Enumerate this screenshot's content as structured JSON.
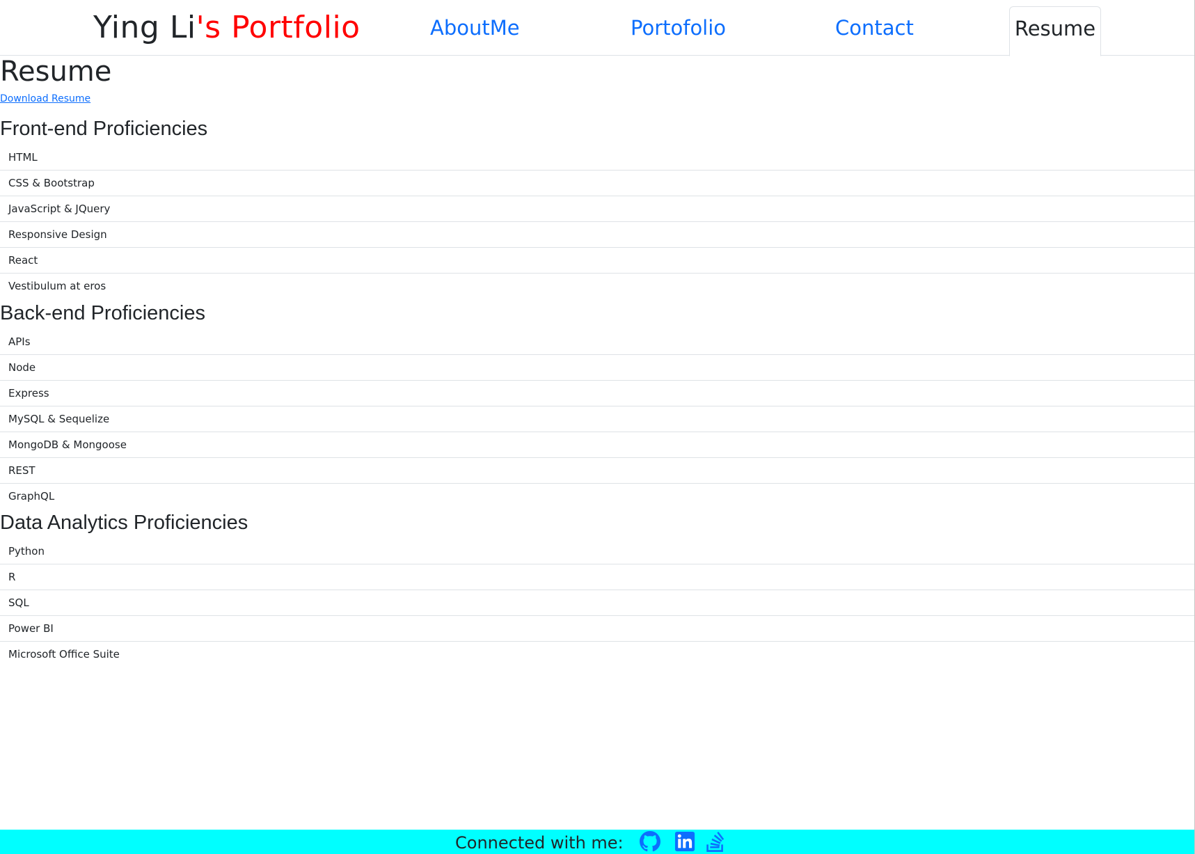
{
  "header": {
    "brand_part1": "Ying Li",
    "brand_part2": "'s Portfolio",
    "nav": {
      "about": "AboutMe",
      "portfolio": "Portofolio",
      "contact": "Contact",
      "resume": "Resume"
    }
  },
  "main": {
    "title": "Resume",
    "download_label": "Download Resume",
    "sections": [
      {
        "title": "Front-end Proficiencies",
        "items": [
          "HTML",
          "CSS & Bootstrap",
          "JavaScript & JQuery",
          "Responsive Design",
          "React",
          "Vestibulum at eros"
        ]
      },
      {
        "title": "Back-end Proficiencies",
        "items": [
          "APIs",
          "Node",
          "Express",
          "MySQL & Sequelize",
          "MongoDB & Mongoose",
          "REST",
          "GraphQL"
        ]
      },
      {
        "title": "Data Analytics Proficiencies",
        "items": [
          "Python",
          "R",
          "SQL",
          "Power BI",
          "Microsoft Office Suite"
        ]
      }
    ]
  },
  "footer": {
    "text": "Connected with me:",
    "icons": [
      "github-icon",
      "linkedin-icon",
      "stack-overflow-icon"
    ]
  },
  "colors": {
    "brand_accent": "#ff0000",
    "link": "#0d6efd",
    "footer_bg": "#00ffff"
  }
}
